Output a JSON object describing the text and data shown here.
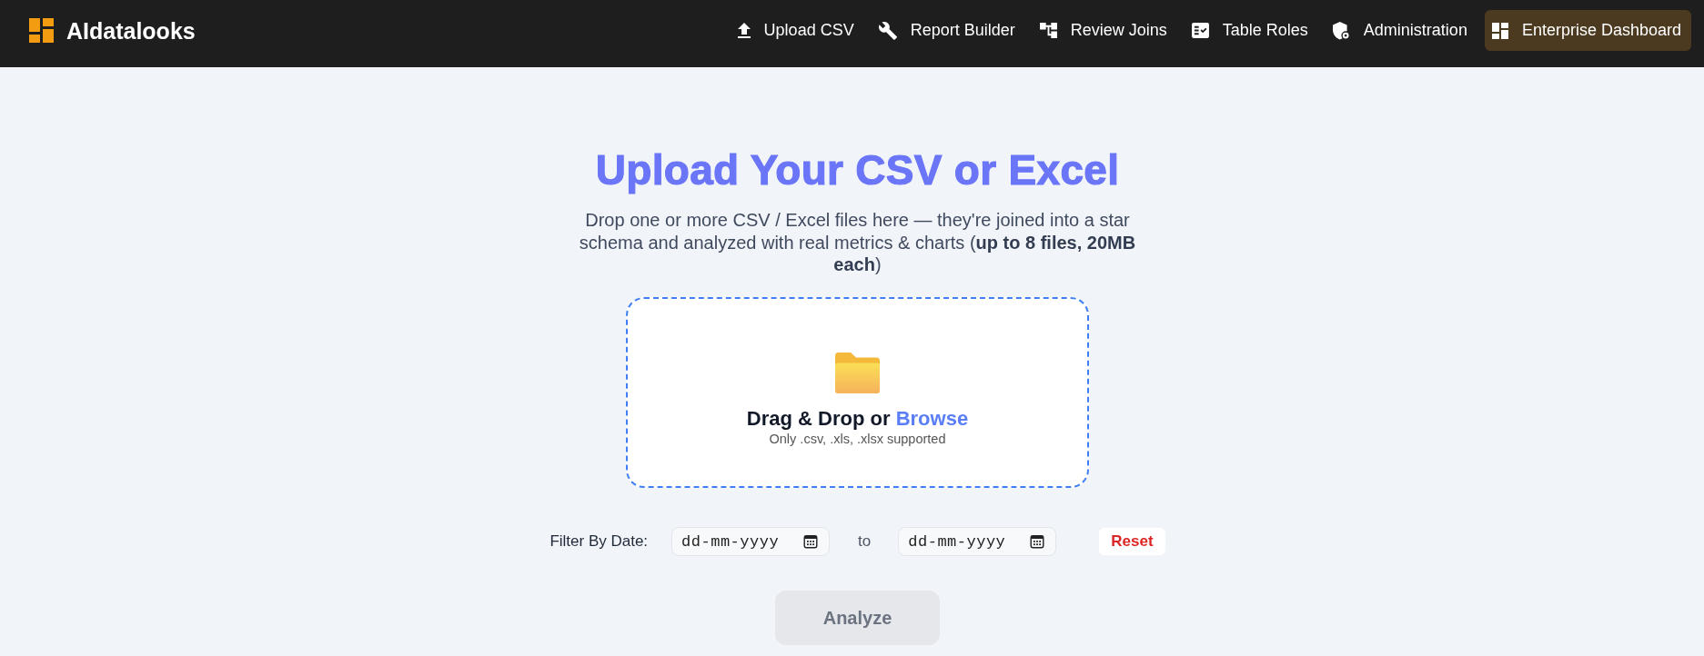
{
  "navbar": {
    "brand": "AIdatalooks",
    "items": [
      {
        "label": "Upload CSV",
        "selected": false
      },
      {
        "label": "Report Builder",
        "selected": false
      },
      {
        "label": "Review Joins",
        "selected": false
      },
      {
        "label": "Table Roles",
        "selected": false
      },
      {
        "label": "Administration",
        "selected": false
      },
      {
        "label": "Enterprise Dashboard",
        "selected": true
      }
    ]
  },
  "hero": {
    "title": "Upload Your CSV or Excel",
    "subtitle": "Drop one or more CSV / Excel files here — they're joined into a star schema and analyzed with real metrics & charts (**up to 8 files, 20MB each**)"
  },
  "dropzone": {
    "prompt": "Drag & Drop or",
    "link": "Browse",
    "hint": "Only .csv, .xls, .xlsx supported"
  },
  "date_filter": {
    "label": "Filter By Date:",
    "from": {
      "placeholder": "dd-mm-yyyy"
    },
    "separator": "to",
    "to": {
      "placeholder": "dd-mm-yyyy"
    },
    "reset": "Reset"
  },
  "analyze_button": {
    "label": "Analyze",
    "disabled": true
  }
}
